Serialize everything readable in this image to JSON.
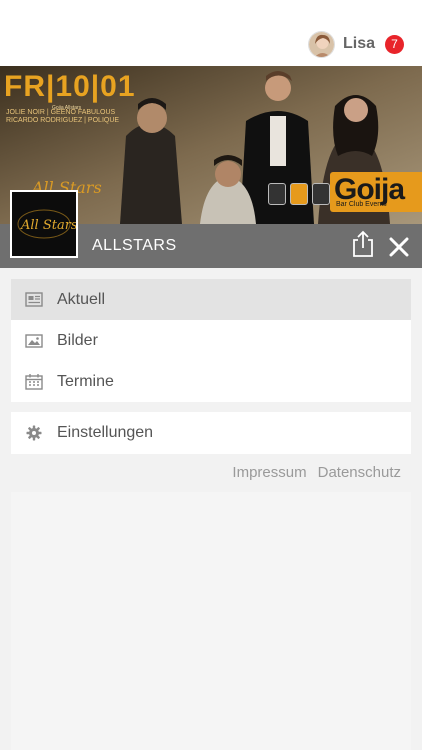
{
  "user": {
    "name": "Lisa",
    "notification_count": "7",
    "badge_color": "#e8242a"
  },
  "hero": {
    "date": "FR|10|01",
    "subtitle": "Goija Allstars",
    "lineup": "JOLIE NOIR | GEENO FABULOUS RICARDO RODRIGUEZ | POLIQUE",
    "logo_script": "All Stars",
    "brand_name": "Goija",
    "brand_tagline": "Bar Club Events",
    "accent_color": "#e69a1c"
  },
  "page": {
    "title": "ALLSTARS",
    "thumbnail_text": "All Stars",
    "share_icon": "share-icon",
    "close_icon": "close-icon"
  },
  "menu": {
    "items": [
      {
        "label": "Aktuell",
        "icon": "newspaper-icon",
        "active": true
      },
      {
        "label": "Bilder",
        "icon": "image-icon",
        "active": false
      },
      {
        "label": "Termine",
        "icon": "calendar-icon",
        "active": false
      }
    ],
    "settings": {
      "label": "Einstellungen",
      "icon": "gear-icon"
    }
  },
  "footer": {
    "impressum": "Impressum",
    "datenschutz": "Datenschutz"
  }
}
